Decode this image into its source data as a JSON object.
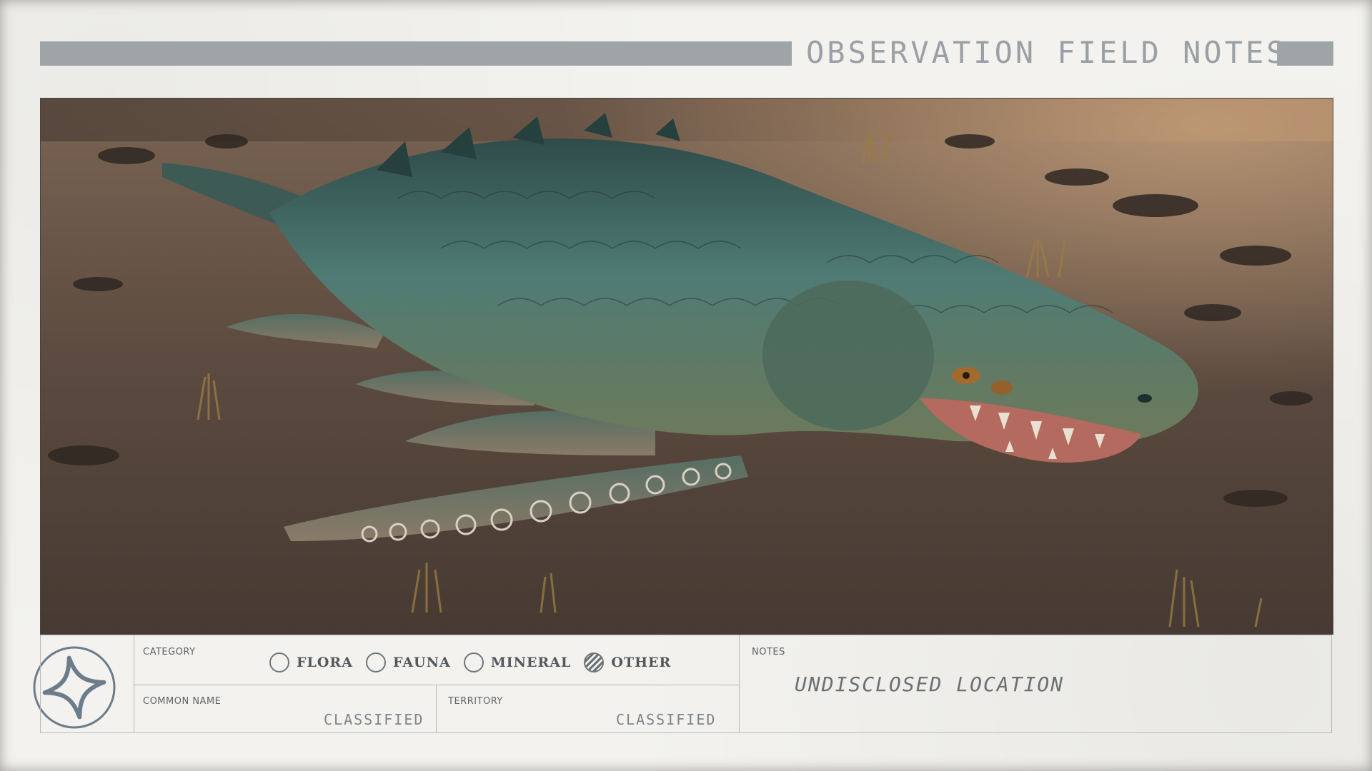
{
  "header": {
    "title": "OBSERVATION FIELD NOTES"
  },
  "photo": {
    "subject": "creature-photo"
  },
  "form": {
    "category": {
      "label": "CATEGORY",
      "options": [
        {
          "label": "FLORA",
          "checked": false
        },
        {
          "label": "FAUNA",
          "checked": false
        },
        {
          "label": "MINERAL",
          "checked": false
        },
        {
          "label": "OTHER",
          "checked": true
        }
      ]
    },
    "common_name": {
      "label": "COMMON NAME",
      "value": "CLASSIFIED"
    },
    "territory": {
      "label": "TERRITORY",
      "value": "CLASSIFIED"
    },
    "notes": {
      "label": "NOTES",
      "value": "UNDISCLOSED LOCATION"
    }
  },
  "emblem": {
    "icon": "constellation-star-icon"
  },
  "colors": {
    "paper": "#f3f2ee",
    "header_bar": "#9fa4a7",
    "ink": "#54595c",
    "ground": "#5a4a3e",
    "creature": "#3f6b66"
  }
}
